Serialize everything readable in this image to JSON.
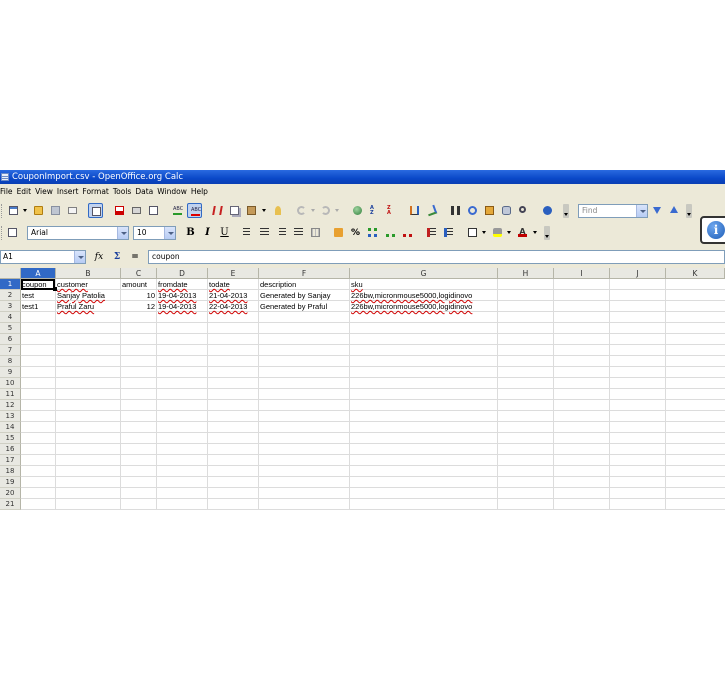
{
  "window": {
    "title": "CouponImport.csv - OpenOffice.org Calc"
  },
  "menu": [
    "File",
    "Edit",
    "View",
    "Insert",
    "Format",
    "Tools",
    "Data",
    "Window",
    "Help"
  ],
  "toolbar": {
    "font_name": "Arial",
    "font_size": "10",
    "find_placeholder": "Find",
    "bold_label": "B",
    "italic_label": "I",
    "underline_label": "U",
    "percent_label": "%"
  },
  "formula_bar": {
    "name_box": "A1",
    "fx_label": "fx",
    "sum_label": "Σ",
    "equals_label": "=",
    "content": "coupon"
  },
  "sheet": {
    "columns": [
      "A",
      "B",
      "C",
      "D",
      "E",
      "F",
      "G",
      "H",
      "I",
      "J",
      "K"
    ],
    "active_column": "A",
    "active_row": 1,
    "active_cell": "A1",
    "row_numbers": [
      "1",
      "2",
      "3",
      "4",
      "5",
      "6",
      "7",
      "8",
      "9",
      "10",
      "11",
      "12",
      "13",
      "14",
      "15",
      "16",
      "17",
      "18",
      "19",
      "20",
      "21"
    ],
    "headers": [
      "coupon",
      "customer",
      "amount",
      "fromdate",
      "todate",
      "description",
      "sku"
    ],
    "rows": [
      [
        "test",
        "Sanjay Patolia",
        "10",
        "19-04-2013",
        "21-04-2013",
        "Generated by Sanjay",
        "226bw,micronmouse5000,logidinovo"
      ],
      [
        "test1",
        "Praful Zaru",
        "12",
        "19-04-2013",
        "22-04-2013",
        "Generated by Praful",
        "226bw,micronmouse5000,logidinovo"
      ]
    ]
  },
  "info_icon": {
    "glyph": "i"
  }
}
